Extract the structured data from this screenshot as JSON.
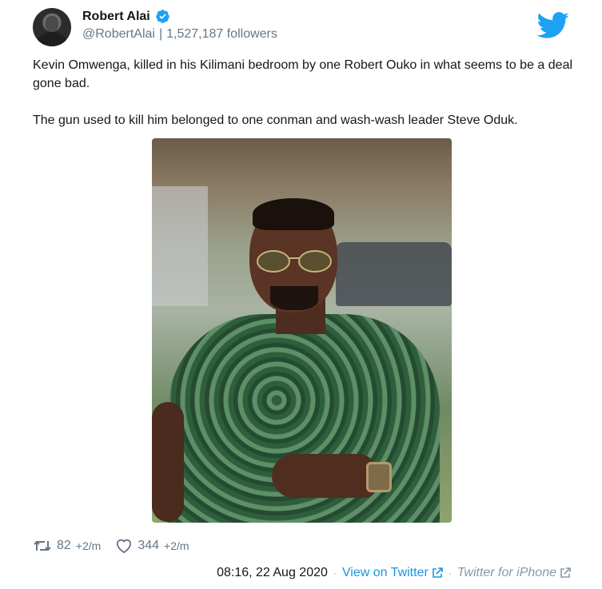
{
  "author": {
    "name": "Robert Alai",
    "handle": "@RobertAlai",
    "separator": "|",
    "followers": "1,527,187 followers"
  },
  "tweet": {
    "line1": "Kevin Omwenga, killed in his Kilimani bedroom by one Robert Ouko in what seems to be a deal gone bad.",
    "line2": "The gun used to kill him belonged to one conman and wash-wash leader Steve Oduk."
  },
  "stats": {
    "retweets": "82",
    "retweets_delta": "+2/m",
    "likes": "344",
    "likes_delta": "+2/m"
  },
  "footer": {
    "timestamp": "08:16, 22 Aug 2020",
    "dot": "·",
    "view_on_twitter": "View on Twitter",
    "source": "Twitter for iPhone"
  },
  "icons": {
    "verified": "verified-badge-icon",
    "twitter": "twitter-bird-icon",
    "retweet": "retweet-icon",
    "like": "heart-icon",
    "external": "external-link-icon"
  },
  "colors": {
    "twitter_blue": "#1da1f2",
    "link_blue": "#1b95e0",
    "muted": "#657786"
  }
}
